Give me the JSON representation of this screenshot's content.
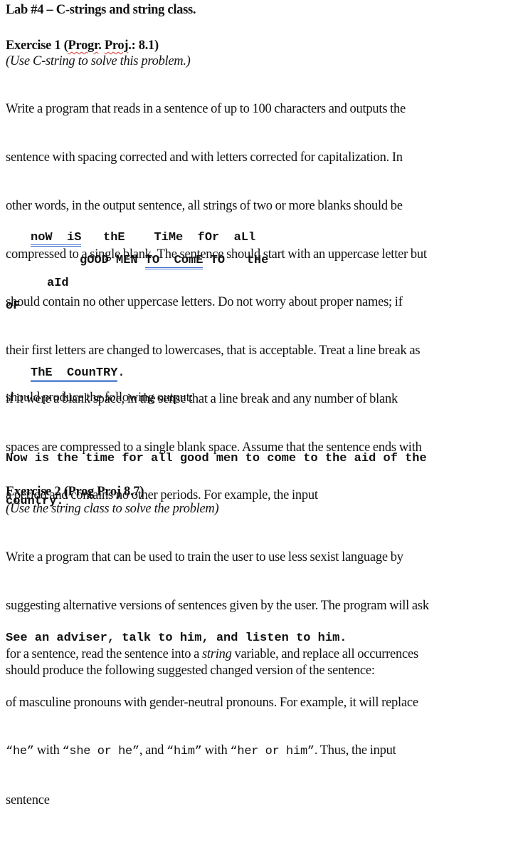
{
  "document": {
    "title": "Lab #4 – C-strings and string class.",
    "exercise1": {
      "heading_prefix": "Exercise 1 (",
      "heading_word1": "Progr",
      "heading_mid": ". ",
      "heading_word2": "Proj",
      "heading_suffix": ".: 8.1)",
      "note": "(Use C-string to solve this problem.)",
      "body_lines": [
        "Write a program that reads in a sentence of up to 100 characters and outputs the",
        "sentence with spacing corrected and with letters corrected for capitalization. In",
        "other words, in the output sentence, all strings of two or more blanks should be",
        "compressed to a single blank. The sentence should start with an uppercase letter but",
        "should contain no other uppercase letters. Do not worry about proper names; if",
        "their first letters are changed to lowercases, that is acceptable. Treat a line break as",
        "if it were a blank space, in the sense that a line break and any number of blank",
        "spaces are compressed to a single blank space. Assume that the sentence ends with",
        "a period and contains no other periods. For example, the input"
      ],
      "input_example": {
        "line1_a": "noW  iS",
        "line1_b": "   thE    TiMe  fOr  aLl",
        "line2_a": "gOOD MEN ",
        "line2_b": "TO  ComE",
        "line2_c": " TO   tHe",
        "line3": "aId",
        "line4": "oF",
        "line5_a": "ThE  CounTRY",
        "line5_b": "."
      },
      "output_intro": "should produce the following output:",
      "output_lines": [
        "Now is the time for all good men to come to the aid of the",
        "country."
      ]
    },
    "exercise2": {
      "heading": "Exercise 2 (Prog Proj 8.7)",
      "note": "(Use the string class to solve the problem)",
      "body_lines": [
        "Write a program that can be used to train the user to use less sexist language by",
        "suggesting alternative versions of sentences given by the user. The program will ask"
      ],
      "line3_a": "for a sentence, read the sentence into a ",
      "line3_italic": "string",
      "line3_b": " variable, and replace all occurrences",
      "line4": "of masculine pronouns with gender-neutral pronouns. For example, it will replace",
      "line5": {
        "code1": "“he”",
        "text1": " with ",
        "code2": "“she or he”",
        "text2": ", and ",
        "code3": "“him”",
        "text3": " with ",
        "code4": "“her or him”",
        "text4": ". Thus, the input"
      },
      "line6": "sentence",
      "input_example": "See an adviser, talk to him, and listen to him.",
      "output_intro": "should produce the following suggested changed version of the sentence:"
    }
  }
}
